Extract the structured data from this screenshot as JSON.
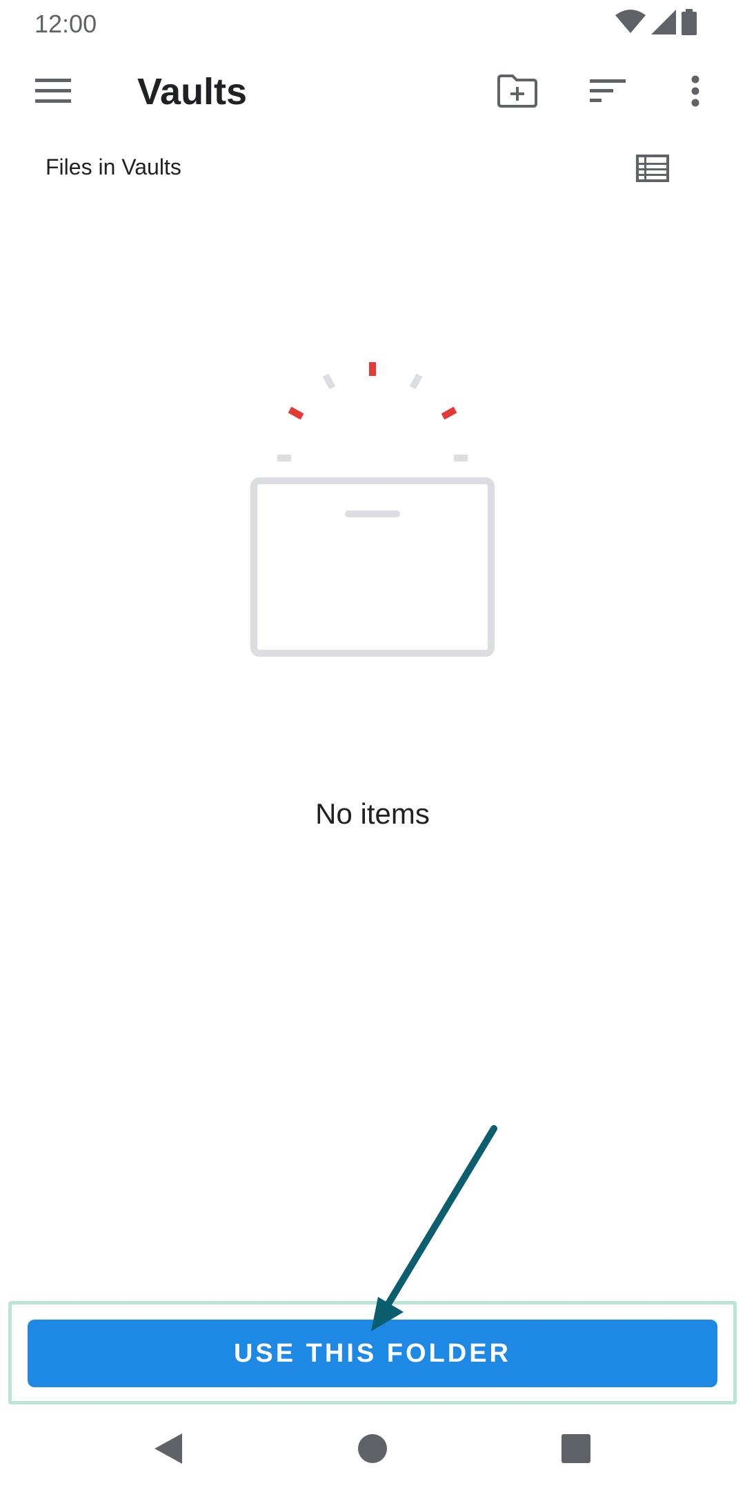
{
  "status_bar": {
    "time": "12:00",
    "icons": [
      "wifi-icon",
      "cellular-signal-icon",
      "battery-icon"
    ]
  },
  "app_bar": {
    "title": "Vaults",
    "icons": [
      "hamburger-menu-icon",
      "create-folder-icon",
      "sort-icon",
      "more-vert-icon"
    ]
  },
  "subheader": {
    "label": "Files in Vaults",
    "view_toggle_icon": "list-view-icon"
  },
  "empty_state": {
    "text": "No items",
    "illustration_icon": "empty-folder-illustration",
    "accent_color": "#e53935",
    "muted_color": "#dcdde1"
  },
  "action": {
    "button_label": "USE THIS FOLDER",
    "button_color": "#1e88e5",
    "highlight_color": "#b9e4d6",
    "arrow_color": "#0b5e6e"
  },
  "nav_bar": {
    "icons": [
      "back-icon",
      "home-icon",
      "recents-icon"
    ]
  }
}
